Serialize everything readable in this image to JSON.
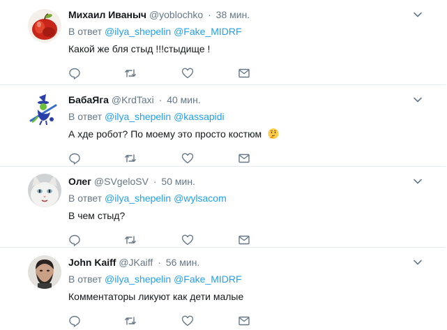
{
  "tweets": [
    {
      "name": "Михаил Иваныч",
      "handle": "@yoblochko",
      "time": "38 мин.",
      "reply_prefix": "В ответ",
      "mentions": [
        "@ilya_shepelin",
        "@Fake_MIDRF"
      ],
      "text": "Какой же бля стыд !!!стыдище !",
      "avatar": "apple-avatar"
    },
    {
      "name": "БабаЯга",
      "handle": "@KrdTaxi",
      "time": "40 мин.",
      "reply_prefix": "В ответ",
      "mentions": [
        "@ilya_shepelin",
        "@kassapidi"
      ],
      "text": "А хде робот?  По моему это просто костюм",
      "emoji": "thinking-face-emoji",
      "avatar": "witch-avatar"
    },
    {
      "name": "Олег",
      "handle": "@SVgeloSV",
      "time": "50 мин.",
      "reply_prefix": "В ответ",
      "mentions": [
        "@ilya_shepelin",
        "@wylsacom"
      ],
      "text": "В чем стыд?",
      "avatar": "cat-avatar"
    },
    {
      "name": "John Kaiff",
      "handle": "@JKaiff",
      "time": "56 мин.",
      "reply_prefix": "В ответ",
      "mentions": [
        "@ilya_shepelin",
        "@Fake_MIDRF"
      ],
      "text": "Комментаторы ликуют как дети малые",
      "avatar": "man-avatar"
    }
  ],
  "dot": "·",
  "colors": {
    "accent": "#1da1f2",
    "muted": "#657786",
    "divider": "#e6ecf0",
    "text": "#14171a"
  }
}
